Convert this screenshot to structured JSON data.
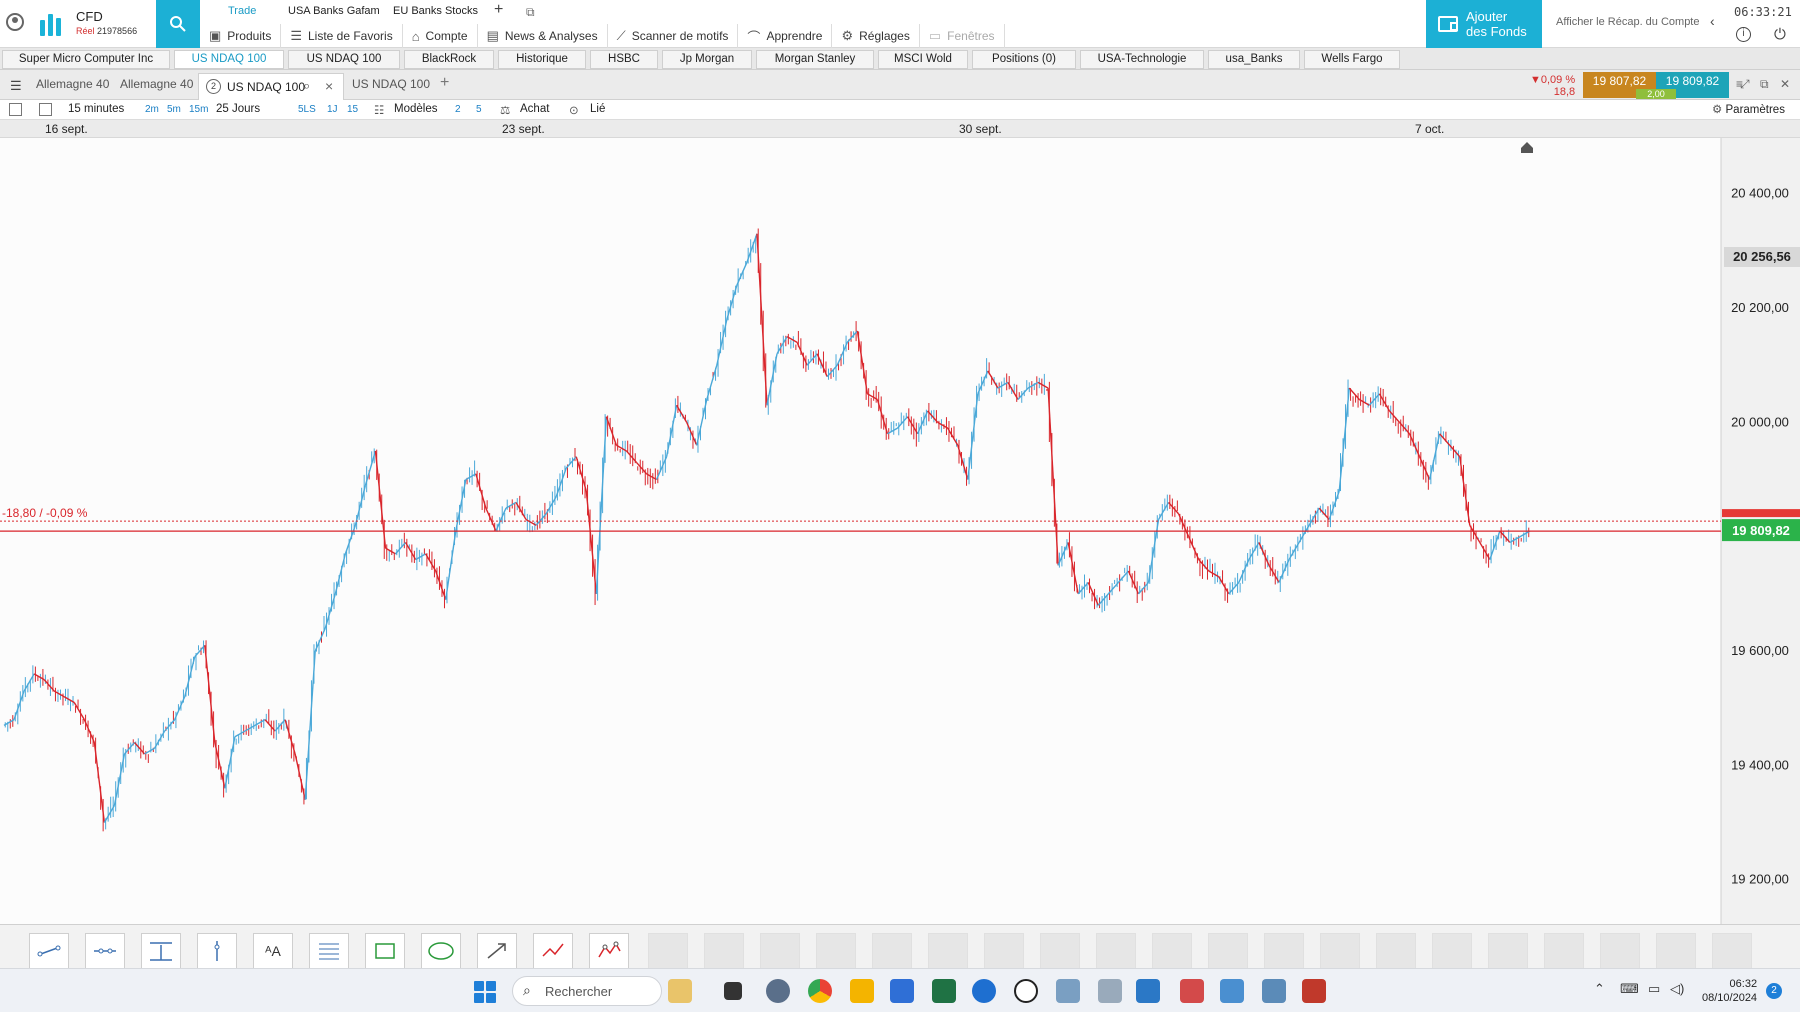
{
  "header": {
    "brand_name": "CFD",
    "account_status": "Réel",
    "account_number": "21978566",
    "top_tabs": [
      "Trade",
      "USA Banks Gafam",
      "EU Banks Stocks"
    ],
    "menu": [
      "Produits",
      "Liste de Favoris",
      "Compte",
      "News & Analyses",
      "Scanner de motifs",
      "Apprendre",
      "Réglages",
      "Fenêtres"
    ],
    "add_funds_line1": "Ajouter",
    "add_funds_line2": "des Fonds",
    "recap": "Afficher le Récap. du Compte",
    "clock": "06:33:21"
  },
  "watchlist": [
    "Super Micro Computer Inc",
    "US NDAQ 100",
    "US NDAQ 100",
    "BlackRock",
    "Historique",
    "HSBC",
    "Jp Morgan",
    "Morgan Stanley",
    "MSCI Wold",
    "Positions (0)",
    "USA-Technologie",
    "usa_Banks",
    "Wells Fargo"
  ],
  "chart_tabs": {
    "inactive_left": [
      "Allemagne 40",
      "Allemagne 40"
    ],
    "active_number": "2",
    "active_title": "US NDAQ 100",
    "inactive_right": "US NDAQ 100"
  },
  "quote": {
    "change_pct": "▼0,09 %",
    "change_abs": "18,8",
    "bid": "19 807,82",
    "ask": "19 809,82",
    "spread": "2,00"
  },
  "toolbar": {
    "interval": "15 minutes",
    "quick_intervals": [
      "2m",
      "5m",
      "15m"
    ],
    "range": "25 Jours",
    "range_buttons": [
      "5LS",
      "1J",
      "15"
    ],
    "models": "Modèles",
    "model_counts": [
      "2",
      "5"
    ],
    "buy": "Achat",
    "linked": "Lié",
    "settings": "Paramètres"
  },
  "date_axis": [
    "16 sept.",
    "23 sept.",
    "30 sept.",
    "7 oct."
  ],
  "chart_data": {
    "type": "line",
    "title": "US NDAQ 100",
    "interval": "15 minutes",
    "range": "25 Jours",
    "x_ticks": [
      "16 sept.",
      "23 sept.",
      "30 sept.",
      "7 oct."
    ],
    "y_ticks": [
      "20 400,00",
      "20 200,00",
      "20 000,00",
      "19 600,00",
      "19 400,00",
      "19 200,00"
    ],
    "y_tick_values": [
      20400,
      20200,
      20000,
      19600,
      19400,
      19200
    ],
    "ylim": [
      19140,
      20480
    ],
    "series": [
      {
        "values": [
          19470,
          19480,
          19530,
          19560,
          19550,
          19530,
          19520,
          19510,
          19480,
          19440,
          19300,
          19330,
          19420,
          19440,
          19420,
          19430,
          19460,
          19480,
          19520,
          19590,
          19610,
          19440,
          19360,
          19450,
          19460,
          19470,
          19480,
          19460,
          19480,
          19420,
          19340,
          19600,
          19640,
          19700,
          19770,
          19820,
          19890,
          19950,
          19780,
          19770,
          19790,
          19760,
          19770,
          19740,
          19690,
          19810,
          19900,
          19910,
          19850,
          19810,
          19850,
          19860,
          19830,
          19820,
          19840,
          19870,
          19920,
          19940,
          19880,
          19700,
          20010,
          19960,
          19950,
          19930,
          19910,
          19900,
          19940,
          20030,
          20000,
          19960,
          20040,
          20100,
          20180,
          20240,
          20280,
          20330,
          20030,
          20120,
          20150,
          20140,
          20100,
          20120,
          20080,
          20100,
          20140,
          20160,
          20050,
          20040,
          19980,
          19990,
          20010,
          19980,
          20020,
          20000,
          19990,
          19960,
          19900,
          20050,
          20090,
          20060,
          20070,
          20040,
          20060,
          20070,
          20060,
          19750,
          19790,
          19700,
          19720,
          19680,
          19700,
          19720,
          19740,
          19700,
          19720,
          19830,
          19860,
          19840,
          19800,
          19760,
          19740,
          19730,
          19700,
          19720,
          19760,
          19790,
          19750,
          19720,
          19760,
          19790,
          19820,
          19850,
          19830,
          19880,
          20060,
          20040,
          20030,
          20050,
          20020,
          20000,
          19980,
          19940,
          19900,
          19980,
          19960,
          19940,
          19820,
          19790,
          19760,
          19810,
          19790,
          19800,
          19810
        ]
      }
    ],
    "last_price": "20 256,56",
    "current_line_label": "-18,80 / -0,09 %",
    "current_price_badge": "19 809,82",
    "current_price": 19809.82
  },
  "draw_tools": [
    "trend-line",
    "horizontal-line",
    "vertical-text",
    "vertical-line",
    "text-annotation",
    "fibonacci",
    "rectangle",
    "ellipse",
    "arrow",
    "polyline",
    "pattern"
  ],
  "taskbar": {
    "search_placeholder": "Rechercher",
    "time": "06:32",
    "date": "08/10/2024",
    "notifications": "2"
  },
  "colors": {
    "accent": "#1cb0d5",
    "up_candle": "#4aa8d8",
    "down_candle": "#d9252b",
    "price_line": "#d9252b",
    "price_badge": "#2bb34a"
  }
}
